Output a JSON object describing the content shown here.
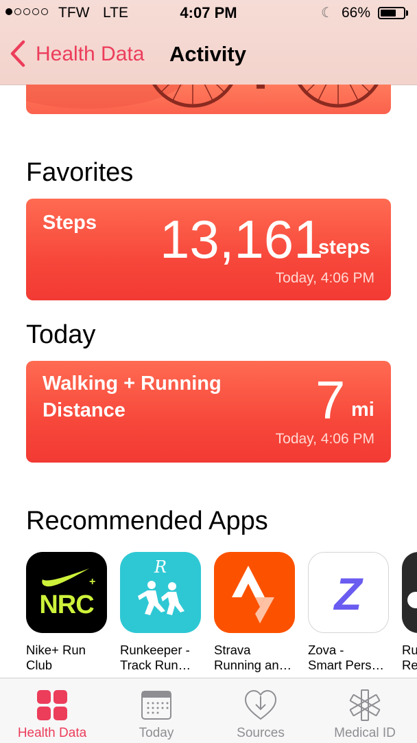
{
  "status_bar": {
    "carrier": "TFW",
    "network": "LTE",
    "time": "4:07 PM",
    "battery": "66%",
    "battery_level": 0.66
  },
  "nav": {
    "back_label": "Health Data",
    "title": "Activity"
  },
  "favorites": {
    "title": "Favorites",
    "card": {
      "label": "Steps",
      "value": "13,161",
      "unit": "steps",
      "time": "Today, 4:06 PM"
    }
  },
  "today": {
    "title": "Today",
    "card": {
      "label_line1": "Walking + Running",
      "label_line2": "Distance",
      "value": "7",
      "unit": "mi",
      "time": "Today, 4:06 PM"
    }
  },
  "recommended": {
    "title": "Recommended Apps",
    "apps": [
      {
        "name_line1": "Nike+ Run",
        "name_line2": "Club",
        "icon_text": "NRC"
      },
      {
        "name_line1": "Runkeeper -",
        "name_line2": "Track Run…"
      },
      {
        "name_line1": "Strava",
        "name_line2": "Running an…"
      },
      {
        "name_line1": "Zova -",
        "name_line2": "Smart Pers…",
        "icon_text": "Z"
      },
      {
        "name_line1": "Ru",
        "name_line2": "Re"
      }
    ]
  },
  "tabbar": {
    "tabs": [
      {
        "label": "Health Data",
        "icon": "health-data-grid-icon",
        "active": true
      },
      {
        "label": "Today",
        "icon": "calendar-icon",
        "active": false
      },
      {
        "label": "Sources",
        "icon": "heart-download-icon",
        "active": false
      },
      {
        "label": "Medical ID",
        "icon": "medical-star-icon",
        "active": false
      }
    ]
  },
  "colors": {
    "accent": "#ec3d5b",
    "card": "#f7473b",
    "nav_bg": "#f6dcd6"
  }
}
